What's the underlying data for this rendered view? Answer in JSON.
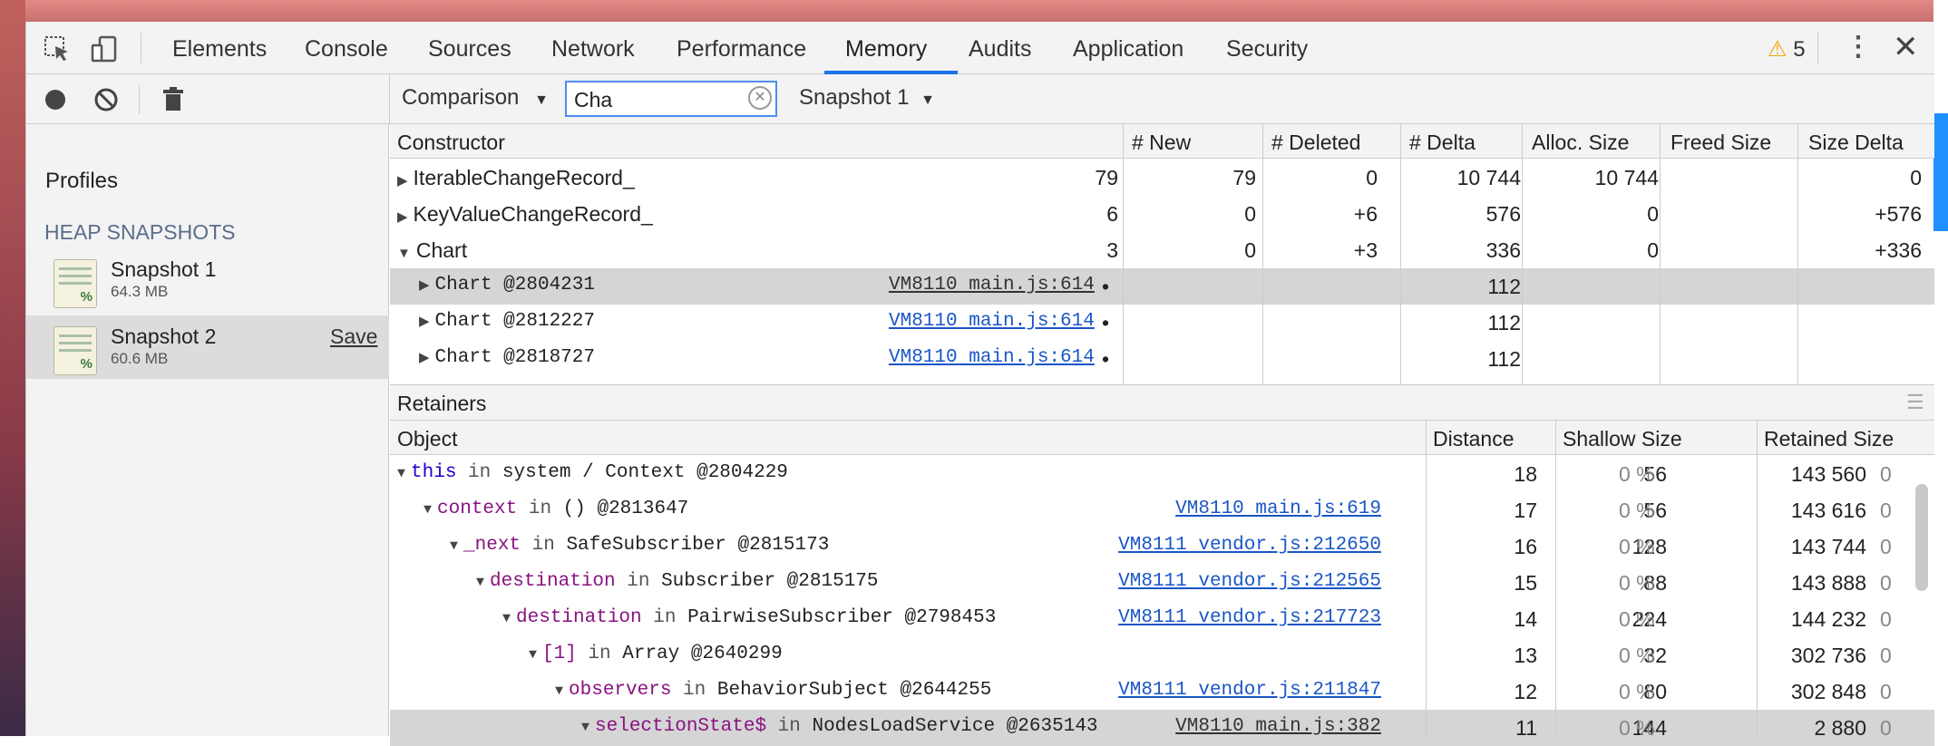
{
  "tabs": [
    "Elements",
    "Console",
    "Sources",
    "Network",
    "Performance",
    "Memory",
    "Audits",
    "Application",
    "Security"
  ],
  "active_tab": "Memory",
  "warnings": {
    "count": "5"
  },
  "toolbar": {
    "view_select": "Comparison",
    "filter_value": "Cha",
    "baseline_select": "Snapshot 1"
  },
  "sidebar": {
    "title": "Profiles",
    "section": "HEAP SNAPSHOTS",
    "snapshots": [
      {
        "name": "Snapshot 1",
        "size": "64.3 MB"
      },
      {
        "name": "Snapshot 2",
        "size": "60.6 MB",
        "save": "Save"
      }
    ]
  },
  "comparison": {
    "headers": [
      "Constructor",
      "# New",
      "# Deleted",
      "# Delta",
      "Alloc. Size",
      "Freed Size",
      "Size Delta"
    ],
    "rows": [
      {
        "name": "IterableChangeRecord_",
        "new": "79",
        "deleted": "79",
        "delta": "0",
        "alloc": "10 744",
        "freed": "10 744",
        "size_delta": "0"
      },
      {
        "name": "KeyValueChangeRecord_",
        "new": "6",
        "deleted": "0",
        "delta": "+6",
        "alloc": "576",
        "freed": "0",
        "size_delta": "+576"
      },
      {
        "name": "Chart",
        "new": "3",
        "deleted": "0",
        "delta": "+3",
        "alloc": "336",
        "freed": "0",
        "size_delta": "+336"
      }
    ],
    "instances": [
      {
        "name": "Chart @2804231",
        "link": "VM8110 main.js:614",
        "new": "•",
        "alloc": "112"
      },
      {
        "name": "Chart @2812227",
        "link": "VM8110 main.js:614",
        "new": "•",
        "alloc": "112"
      },
      {
        "name": "Chart @2818727",
        "link": "VM8110 main.js:614",
        "new": "•",
        "alloc": "112"
      }
    ]
  },
  "retainers": {
    "title": "Retainers",
    "headers": [
      "Object",
      "Distance",
      "Shallow Size",
      "Retained Size"
    ],
    "rows": [
      {
        "prop": "this",
        "in": " in ",
        "obj": "system / Context @2804229",
        "link": "",
        "distance": "18",
        "shallow": "56",
        "shallow_pct": "0 %",
        "retained": "143 560",
        "retained_pct": "0"
      },
      {
        "prop": "context",
        "in": " in ",
        "obj": "() @2813647",
        "link": "VM8110 main.js:619",
        "distance": "17",
        "shallow": "56",
        "shallow_pct": "0 %",
        "retained": "143 616",
        "retained_pct": "0"
      },
      {
        "prop": "_next",
        "in": " in ",
        "obj": "SafeSubscriber @2815173",
        "link": "VM8111 vendor.js:212650",
        "distance": "16",
        "shallow": "128",
        "shallow_pct": "0 %",
        "retained": "143 744",
        "retained_pct": "0"
      },
      {
        "prop": "destination",
        "in": " in ",
        "obj": "Subscriber @2815175",
        "link": "VM8111 vendor.js:212565",
        "distance": "15",
        "shallow": "88",
        "shallow_pct": "0 %",
        "retained": "143 888",
        "retained_pct": "0"
      },
      {
        "prop": "destination",
        "in": " in ",
        "obj": "PairwiseSubscriber @2798453",
        "link": "VM8111 vendor.js:217723",
        "distance": "14",
        "shallow": "224",
        "shallow_pct": "0 %",
        "retained": "144 232",
        "retained_pct": "0"
      },
      {
        "prop": "[1]",
        "in": " in ",
        "obj": "Array @2640299",
        "link": "",
        "distance": "13",
        "shallow": "32",
        "shallow_pct": "0 %",
        "retained": "302 736",
        "retained_pct": "0"
      },
      {
        "prop": "observers",
        "in": " in ",
        "obj": "BehaviorSubject @2644255",
        "link": "VM8111 vendor.js:211847",
        "distance": "12",
        "shallow": "80",
        "shallow_pct": "0 %",
        "retained": "302 848",
        "retained_pct": "0"
      },
      {
        "prop": "selectionState$",
        "in": " in ",
        "obj": "NodesLoadService @2635143",
        "link": "VM8110 main.js:382",
        "distance": "11",
        "shallow": "144",
        "shallow_pct": "0 %",
        "retained": "2 880",
        "retained_pct": "0"
      }
    ]
  }
}
